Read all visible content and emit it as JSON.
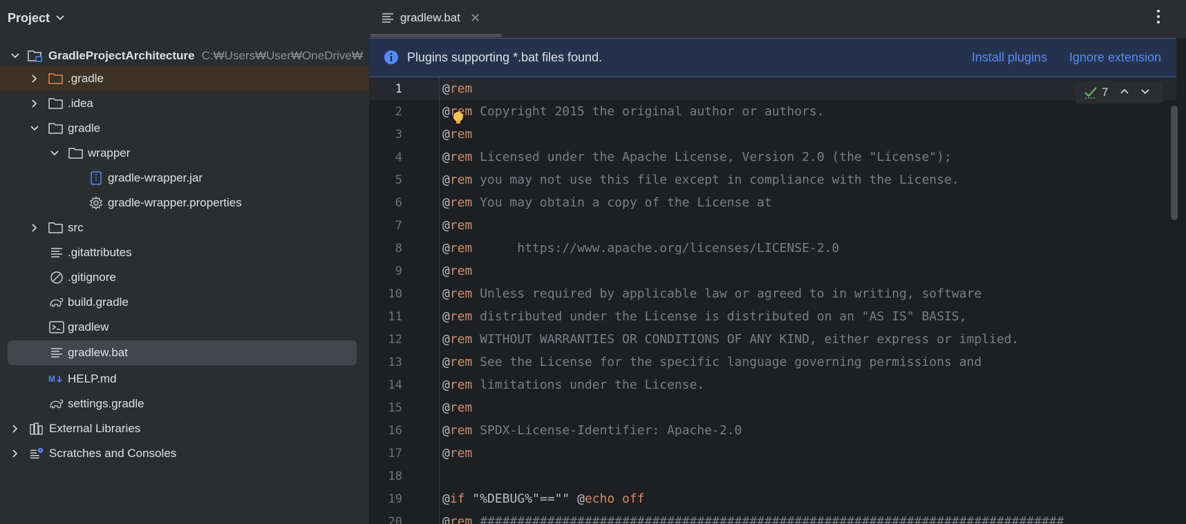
{
  "project_panel": {
    "title": "Project",
    "tree": [
      {
        "label": "GradleProjectArchitecture",
        "path": "C:₩Users₩User₩OneDrive₩",
        "icon": "project-folder-icon"
      },
      {
        "label": ".gradle",
        "icon": "folder-orange-icon"
      },
      {
        "label": ".idea",
        "icon": "folder-icon"
      },
      {
        "label": "gradle",
        "icon": "folder-icon"
      },
      {
        "label": "wrapper",
        "icon": "folder-icon"
      },
      {
        "label": "gradle-wrapper.jar",
        "icon": "archive-icon"
      },
      {
        "label": "gradle-wrapper.properties",
        "icon": "gear-icon"
      },
      {
        "label": "src",
        "icon": "folder-icon"
      },
      {
        "label": ".gitattributes",
        "icon": "text-file-icon"
      },
      {
        "label": ".gitignore",
        "icon": "ignore-file-icon"
      },
      {
        "label": "build.gradle",
        "icon": "gradle-elephant-icon"
      },
      {
        "label": "gradlew",
        "icon": "terminal-icon"
      },
      {
        "label": "gradlew.bat",
        "icon": "text-file-icon"
      },
      {
        "label": "HELP.md",
        "icon": "markdown-icon"
      },
      {
        "label": "settings.gradle",
        "icon": "gradle-elephant-icon"
      },
      {
        "label": "External Libraries",
        "icon": "library-icon"
      },
      {
        "label": "Scratches and Consoles",
        "icon": "scratches-icon"
      }
    ]
  },
  "editor": {
    "tab_label": "gradlew.bat",
    "banner": {
      "text": "Plugins supporting *.bat files found.",
      "install_label": "Install plugins",
      "ignore_label": "Ignore extension"
    },
    "inspection_count": "7",
    "lines": [
      {
        "n": "1",
        "kw": "rem",
        "text": ""
      },
      {
        "n": "2",
        "kw": "rem",
        "text": "Copyright 2015 the original author or authors."
      },
      {
        "n": "3",
        "kw": "rem",
        "text": ""
      },
      {
        "n": "4",
        "kw": "rem",
        "text": "Licensed under the Apache License, Version 2.0 (the \"License\");"
      },
      {
        "n": "5",
        "kw": "rem",
        "text": "you may not use this file except in compliance with the License."
      },
      {
        "n": "6",
        "kw": "rem",
        "text": "You may obtain a copy of the License at"
      },
      {
        "n": "7",
        "kw": "rem",
        "text": ""
      },
      {
        "n": "8",
        "kw": "rem",
        "text": "     https://www.apache.org/licenses/LICENSE-2.0"
      },
      {
        "n": "9",
        "kw": "rem",
        "text": ""
      },
      {
        "n": "10",
        "kw": "rem",
        "text": "Unless required by applicable law or agreed to in writing, software"
      },
      {
        "n": "11",
        "kw": "rem",
        "text": "distributed under the License is distributed on an \"AS IS\" BASIS,"
      },
      {
        "n": "12",
        "kw": "rem",
        "text": "WITHOUT WARRANTIES OR CONDITIONS OF ANY KIND, either express or implied."
      },
      {
        "n": "13",
        "kw": "rem",
        "text": "See the License for the specific language governing permissions and"
      },
      {
        "n": "14",
        "kw": "rem",
        "text": "limitations under the License."
      },
      {
        "n": "15",
        "kw": "rem",
        "text": ""
      },
      {
        "n": "16",
        "kw": "rem",
        "text": "SPDX-License-Identifier: Apache-2.0"
      },
      {
        "n": "17",
        "kw": "rem",
        "text": ""
      },
      {
        "n": "18",
        "kw": "",
        "text": ""
      },
      {
        "n": "19",
        "kw": "if",
        "text": "\"%DEBUG%\"==\"\" ",
        "kw2": "echo",
        "text2": " off"
      },
      {
        "n": "20",
        "kw": "rem",
        "text": "##############################################################################"
      }
    ]
  },
  "colors": {
    "accent_link": "#548af7",
    "keyword": "#cf8e6d",
    "comment": "#7a7e85",
    "panel_bg": "#2b2d30",
    "editor_bg": "#1e1f22"
  }
}
